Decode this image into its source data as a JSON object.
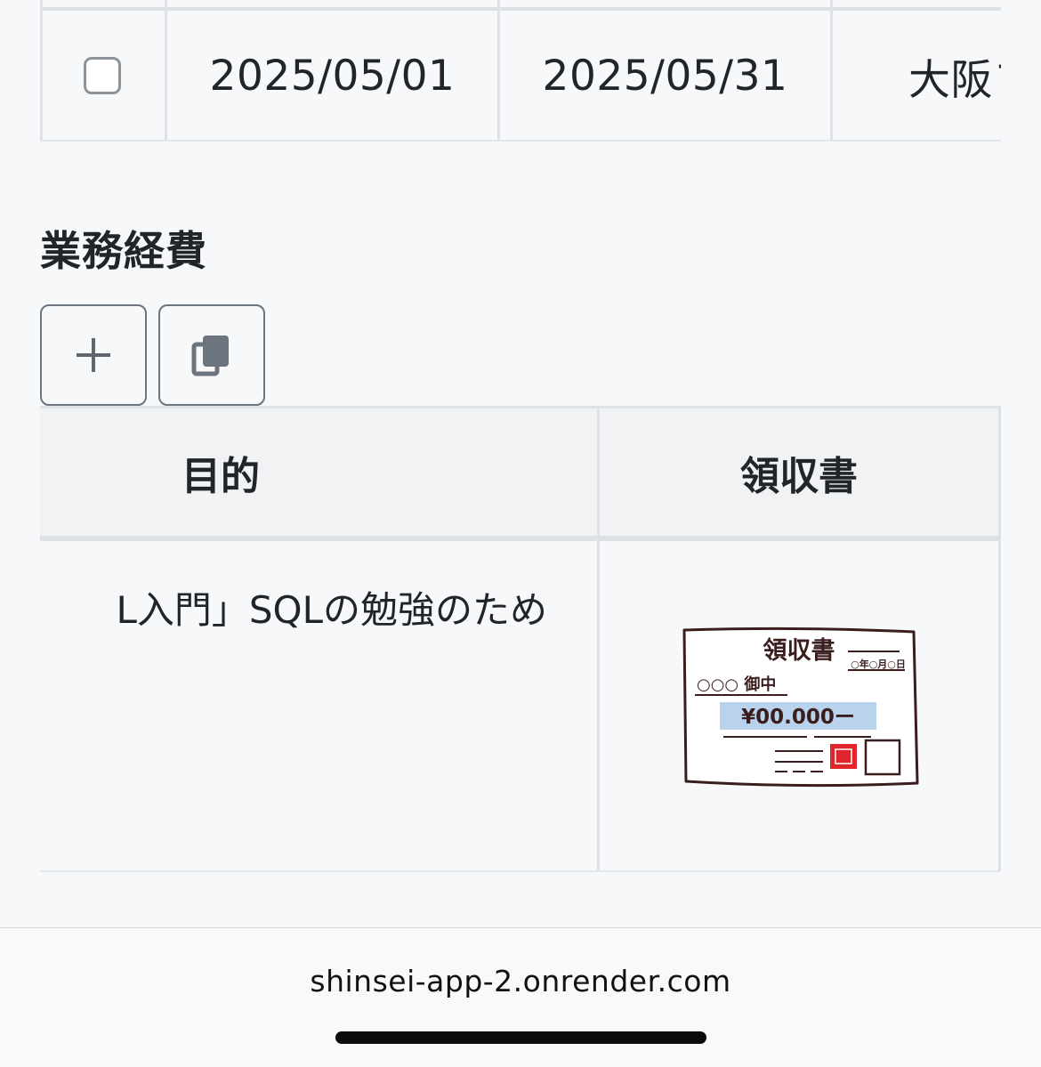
{
  "commute_table": {
    "row": {
      "checked": false,
      "start_date": "2025/05/01",
      "end_date": "2025/05/31",
      "route_start": "大阪フ"
    }
  },
  "expenses": {
    "title": "業務経費",
    "add_button_icon": "plus-icon",
    "copy_button_icon": "copy-icon",
    "columns": {
      "purpose": "目的",
      "receipt": "領収書"
    },
    "rows": [
      {
        "purpose": "「SQL入門」SQLの勉強のため",
        "purpose_visible": "L入門」SQLの勉強のため",
        "receipt": {
          "title": "領収書",
          "date": "○年○月○日",
          "addressee": "○○○ 御中",
          "amount": "¥00.000ー"
        }
      }
    ]
  },
  "browser": {
    "url": "shinsei-app-2.onrender.com"
  },
  "colors": {
    "background": "#f7f8fa",
    "border": "#dee2e6",
    "button_border": "#6c757d",
    "receipt_amount_bg": "#b9d3ec",
    "stamp_red": "#e0252b"
  }
}
